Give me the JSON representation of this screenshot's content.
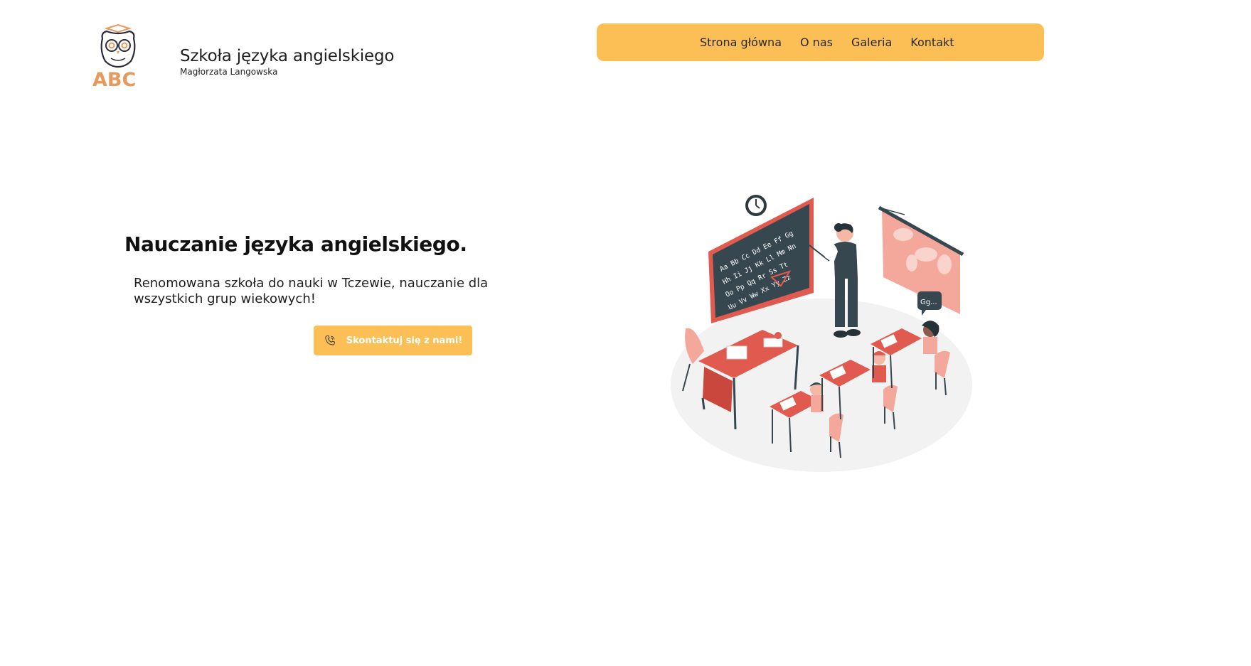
{
  "header": {
    "logo_text": "ABC",
    "title": "Szkoła języka angielskiego",
    "subtitle": "Magłorzata Langowska"
  },
  "nav": {
    "items": [
      {
        "label": "Strona główna"
      },
      {
        "label": "O nas"
      },
      {
        "label": "Galeria"
      },
      {
        "label": "Kontakt"
      }
    ]
  },
  "hero": {
    "heading": "Nauczanie języka angielskiego.",
    "description": "Renomowana szkoła do nauki w Tczewie, nauczanie dla wszystkich grup wiekowych!",
    "cta_label": "Skontaktuj się z nami!",
    "cta_icon": "phone-icon"
  },
  "illustration": {
    "board_letters": [
      "Aa Bb Cc Dd Ee Ff Gg",
      "Hh Ii Jj Kk Ll Mm Nn",
      "Oo Pp Qq Rr Ss Tt",
      "Uu Vv Ww Xx Yy Zz"
    ],
    "speech_bubble": "Gg..."
  },
  "colors": {
    "accent": "#fbbf55",
    "logo_orange": "#e69a5f",
    "illustration_red": "#e05a4f",
    "illustration_pink": "#f4a79b"
  }
}
